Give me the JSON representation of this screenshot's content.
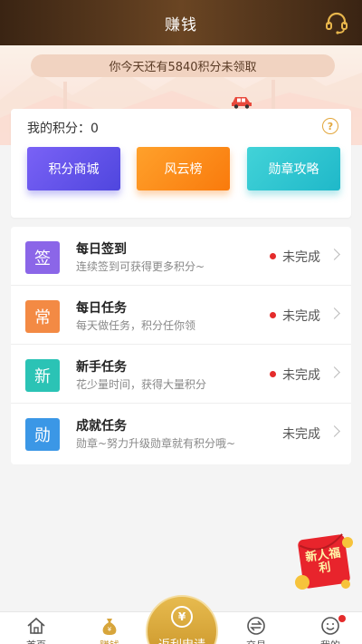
{
  "header": {
    "title": "赚钱"
  },
  "notice": {
    "text": "你今天还有5840积分未领取"
  },
  "points": {
    "label": "我的积分：0",
    "help": "?",
    "buttons": [
      "积分商城",
      "风云榜",
      "勋章攻略"
    ]
  },
  "tasks": [
    {
      "icon_char": "签",
      "title": "每日签到",
      "desc": "连续签到可获得更多积分~",
      "status": "未完成",
      "dot": true,
      "color": "#8b66e8"
    },
    {
      "icon_char": "常",
      "title": "每日任务",
      "desc": "每天做任务，积分任你领",
      "status": "未完成",
      "dot": true,
      "color": "#f38a44"
    },
    {
      "icon_char": "新",
      "title": "新手任务",
      "desc": "花少量时间，获得大量积分",
      "status": "未完成",
      "dot": true,
      "color": "#2bc3b5"
    },
    {
      "icon_char": "勋",
      "title": "成就任务",
      "desc": "勋章~努力升级勋章就有积分哦~",
      "status": "未完成",
      "dot": false,
      "color": "#3b97e6"
    }
  ],
  "envelope": {
    "text": "新人福利"
  },
  "nav": {
    "home": "首页",
    "earn": "赚钱",
    "center": "返利申请",
    "center_coin": "¥",
    "trade": "交易",
    "mine": "我的"
  },
  "colors": {
    "header_bg": "#4a2f19",
    "accent_gold": "#c9962f",
    "status_dot": "#e42b2b"
  }
}
